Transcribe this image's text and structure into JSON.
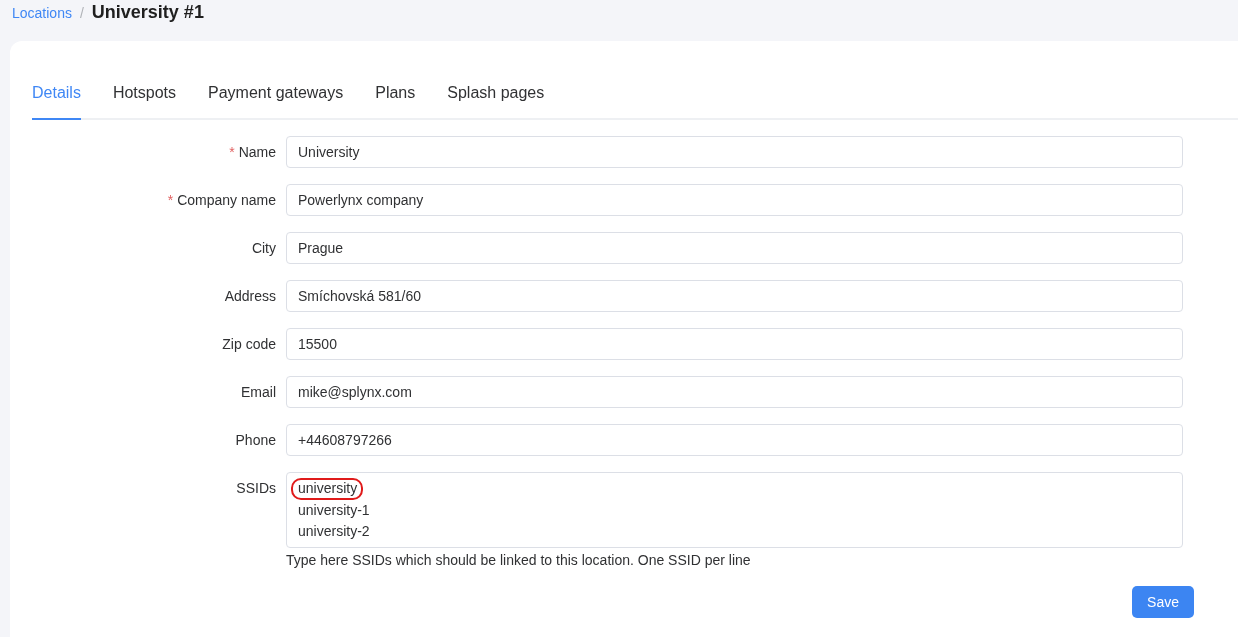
{
  "breadcrumb": {
    "parent": "Locations",
    "separator": "/",
    "current": "University #1"
  },
  "tabs": [
    {
      "label": "Details",
      "selected": true
    },
    {
      "label": "Hotspots",
      "selected": false
    },
    {
      "label": "Payment gateways",
      "selected": false
    },
    {
      "label": "Plans",
      "selected": false
    },
    {
      "label": "Splash pages",
      "selected": false
    }
  ],
  "fields": [
    {
      "required_mark": "*",
      "label": "Name",
      "value": "University"
    },
    {
      "required_mark": "*",
      "label": "Company name",
      "value": "Powerlynx company"
    },
    {
      "label": "City",
      "value": "Prague"
    },
    {
      "label": "Address",
      "value": "Smíchovská 581/60"
    },
    {
      "label": "Zip code",
      "value": "15500"
    },
    {
      "label": "Email",
      "value": "mike@splynx.com"
    },
    {
      "label": "Phone",
      "value": "+44608797266"
    }
  ],
  "ssids": {
    "label": "SSIDs",
    "lines": [
      {
        "text": "university",
        "highlighted": true
      },
      {
        "text": "university-1",
        "highlighted": false
      },
      {
        "text": "university-2",
        "highlighted": false
      }
    ],
    "help": "Type here SSIDs which should be linked to this location. One SSID per line"
  },
  "save_button": "Save"
}
